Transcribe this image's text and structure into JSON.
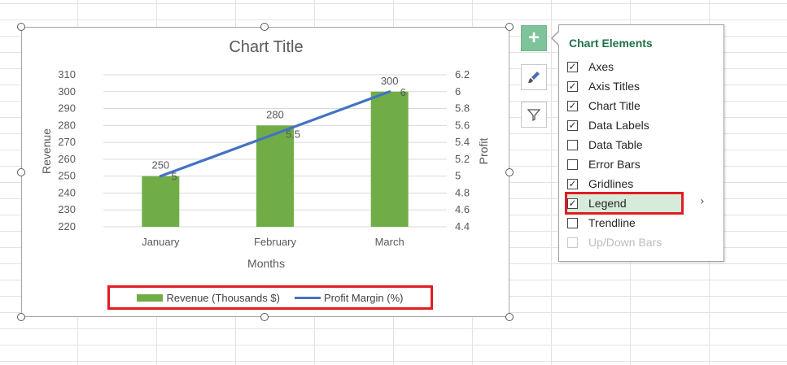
{
  "chart": {
    "title": "Chart Title",
    "legend": {
      "bar_label": "Revenue (Thousands $)",
      "line_label": "Profit Margin (%)"
    }
  },
  "chart_data": {
    "type": "bar",
    "title": "Chart Title",
    "xlabel": "Months",
    "ylabel": "Revenue",
    "y2label": "Profit",
    "categories": [
      "January",
      "February",
      "March"
    ],
    "ylim": [
      220,
      310
    ],
    "y2lim": [
      4.4,
      6.2
    ],
    "y_ticks": [
      220,
      230,
      240,
      250,
      260,
      270,
      280,
      290,
      300,
      310
    ],
    "y2_ticks": [
      "4.4",
      "4.6",
      "4.8",
      "5",
      "5.2",
      "5.4",
      "5.6",
      "5.8",
      "6",
      "6.2"
    ],
    "series": [
      {
        "name": "Revenue (Thousands $)",
        "type": "bar",
        "axis": "primary",
        "values": [
          250,
          280,
          300
        ],
        "color": "#70ad47"
      },
      {
        "name": "Profit Margin (%)",
        "type": "line",
        "axis": "secondary",
        "values": [
          5,
          5.5,
          6
        ],
        "color": "#4472c4"
      }
    ],
    "data_labels": true,
    "gridlines": true,
    "legend_position": "bottom"
  },
  "flyout": {
    "title": "Chart Elements",
    "items": [
      {
        "label": "Axes",
        "checked": true,
        "enabled": true
      },
      {
        "label": "Axis Titles",
        "checked": true,
        "enabled": true
      },
      {
        "label": "Chart Title",
        "checked": true,
        "enabled": true
      },
      {
        "label": "Data Labels",
        "checked": true,
        "enabled": true
      },
      {
        "label": "Data Table",
        "checked": false,
        "enabled": true
      },
      {
        "label": "Error Bars",
        "checked": false,
        "enabled": true
      },
      {
        "label": "Gridlines",
        "checked": true,
        "enabled": true
      },
      {
        "label": "Legend",
        "checked": true,
        "enabled": true,
        "highlighted": true
      },
      {
        "label": "Trendline",
        "checked": false,
        "enabled": true
      },
      {
        "label": "Up/Down Bars",
        "checked": false,
        "enabled": false
      }
    ],
    "check_glyph": "✓",
    "chevron": "›"
  },
  "tools": {
    "plus_glyph": "+"
  },
  "colors": {
    "bar": "#70ad47",
    "line": "#4472c4",
    "highlight_border": "#e11c24",
    "flyout_title": "#1e7145"
  }
}
